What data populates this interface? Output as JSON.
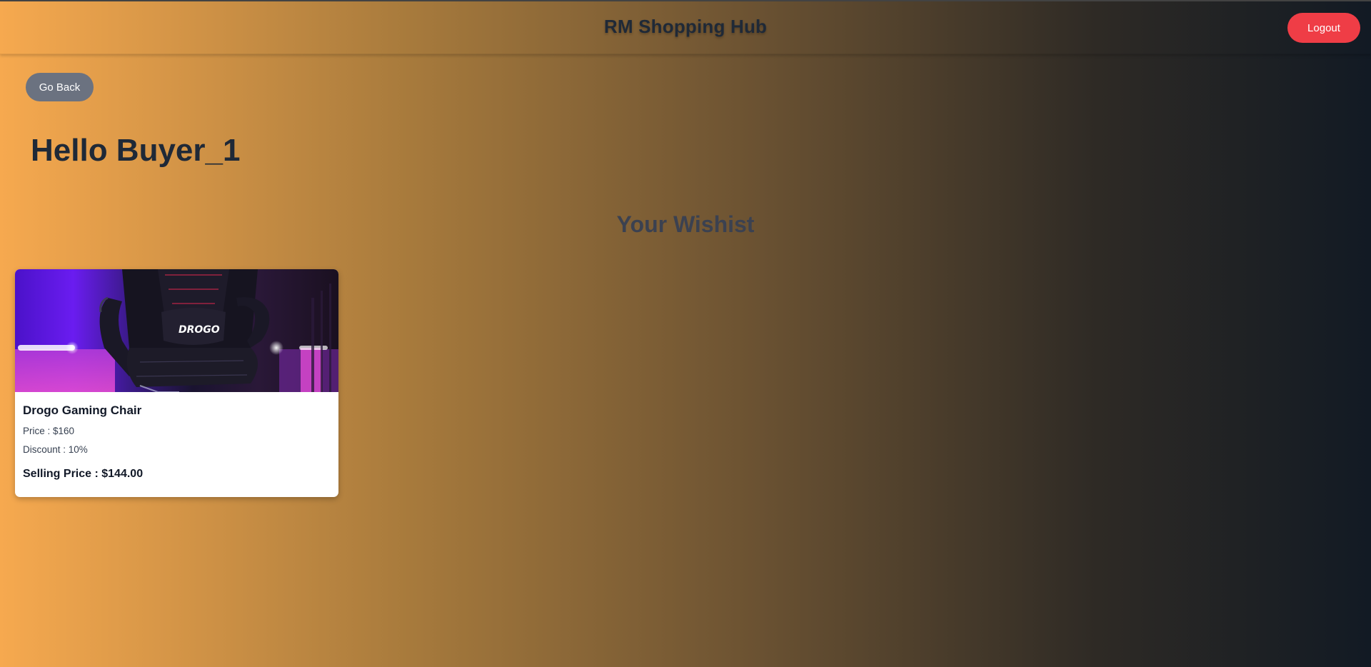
{
  "header": {
    "title": "RM Shopping Hub",
    "logout_label": "Logout"
  },
  "nav": {
    "back_label": "Go Back"
  },
  "greeting": "Hello Buyer_1",
  "wishlist": {
    "title": "Your Wishist",
    "items": [
      {
        "image_icon": "gaming-chair-photo",
        "image_text": "DROGO",
        "name": "Drogo Gaming Chair",
        "price_text": "Price : $160",
        "discount_text": "Discount : 10%",
        "selling_price_text": "Selling Price : $144.00"
      }
    ]
  },
  "colors": {
    "logout": "#ef3d46",
    "back": "#6b7280",
    "gradient_start": "#f6a94f",
    "gradient_end": "#121a24"
  }
}
